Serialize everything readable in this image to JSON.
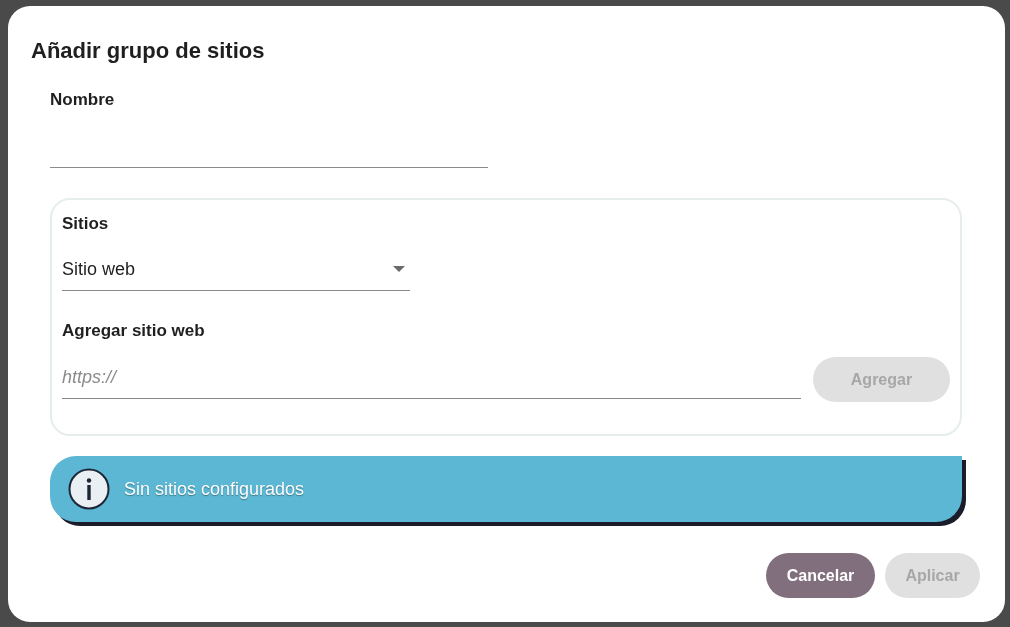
{
  "dialog": {
    "title": "Añadir grupo de sitios"
  },
  "name_field": {
    "label": "Nombre"
  },
  "sites": {
    "title": "Sitios",
    "type_select": {
      "value": "Sitio web"
    },
    "add_site": {
      "label": "Agregar sitio web",
      "placeholder": "https://",
      "button": {
        "label": "Agregar",
        "disabled": true
      }
    }
  },
  "notice": {
    "kind": "info",
    "text": "Sin sitios configurados"
  },
  "buttons": [
    {
      "label": "Cancelar",
      "disabled": false
    },
    {
      "label": "Aplicar",
      "disabled": true
    }
  ]
}
